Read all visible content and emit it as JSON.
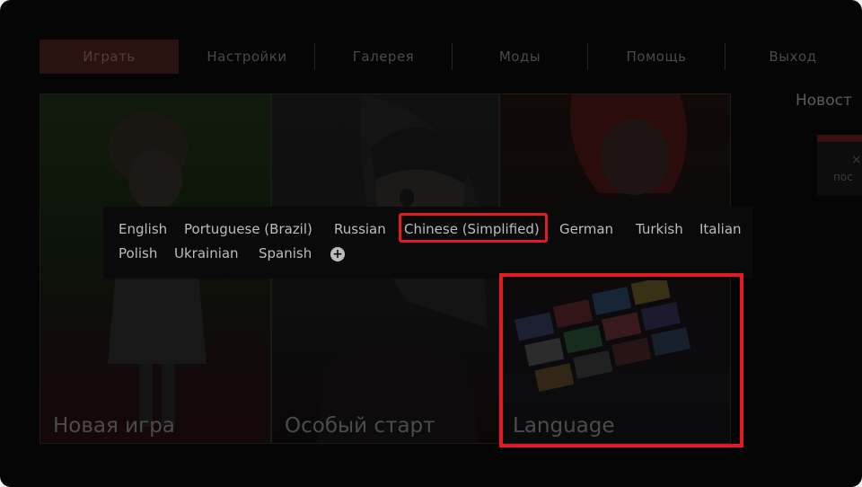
{
  "nav": {
    "tabs": [
      {
        "label": "Играть",
        "active": true
      },
      {
        "label": "Настройки",
        "active": false
      },
      {
        "label": "Галерея",
        "active": false
      },
      {
        "label": "Моды",
        "active": false
      },
      {
        "label": "Помощь",
        "active": false
      },
      {
        "label": "Выход",
        "active": false
      }
    ]
  },
  "news": {
    "title": "Новост",
    "close": "×",
    "snippet": "пос"
  },
  "cards": [
    {
      "title": "Новая игра"
    },
    {
      "title": "Особый старт"
    },
    {
      "title": "Language"
    }
  ],
  "language_menu": {
    "options": [
      "English",
      "Portuguese (Brazil)",
      "Russian",
      "Chinese (Simplified)",
      "German",
      "Turkish",
      "Italian",
      "Polish",
      "Ukrainian",
      "Spanish"
    ],
    "highlighted": "Chinese (Simplified)",
    "more_icon": "plus-circle-icon"
  },
  "colors": {
    "highlight": "#e21b23",
    "background": "#050505",
    "active_tab": "#2a1210"
  }
}
